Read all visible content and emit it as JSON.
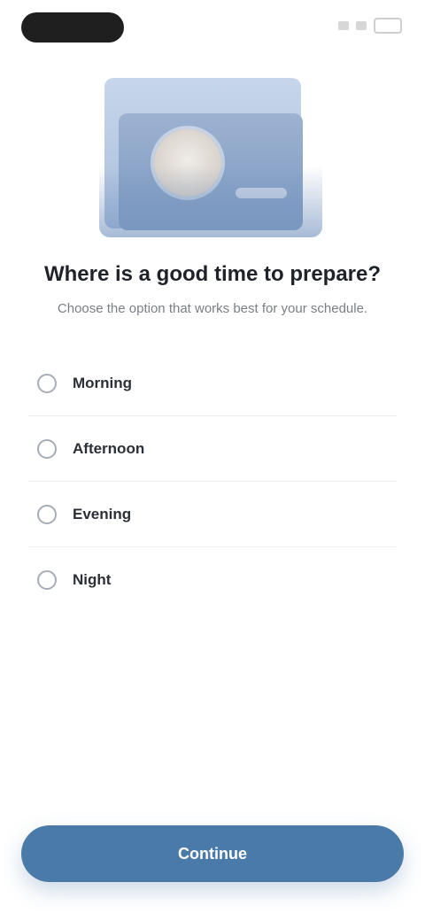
{
  "header": {
    "status_icons": [
      "signal-icon",
      "wifi-icon",
      "battery-icon"
    ]
  },
  "hero": {
    "illustration": "face-photo-illustration"
  },
  "content": {
    "title": "Where is a good time to prepare?",
    "subtitle": "Choose the option that works best for your schedule."
  },
  "options": [
    {
      "label": "Morning"
    },
    {
      "label": "Afternoon"
    },
    {
      "label": "Evening"
    },
    {
      "label": "Night"
    }
  ],
  "footer": {
    "continue_label": "Continue"
  },
  "colors": {
    "primary": "#4a7aa8",
    "text": "#1f2329",
    "muted": "#7a7f86"
  }
}
